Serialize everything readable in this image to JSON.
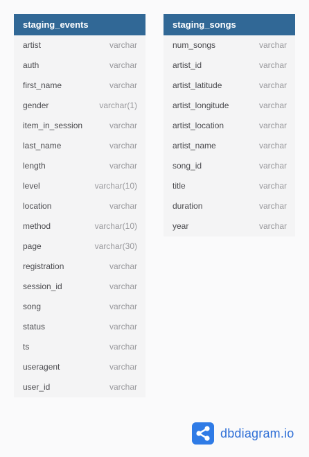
{
  "tables": [
    {
      "name": "staging_events",
      "columns": [
        {
          "name": "artist",
          "type": "varchar"
        },
        {
          "name": "auth",
          "type": "varchar"
        },
        {
          "name": "first_name",
          "type": "varchar"
        },
        {
          "name": "gender",
          "type": "varchar(1)"
        },
        {
          "name": "item_in_session",
          "type": "varchar"
        },
        {
          "name": "last_name",
          "type": "varchar"
        },
        {
          "name": "length",
          "type": "varchar"
        },
        {
          "name": "level",
          "type": "varchar(10)"
        },
        {
          "name": "location",
          "type": "varchar"
        },
        {
          "name": "method",
          "type": "varchar(10)"
        },
        {
          "name": "page",
          "type": "varchar(30)"
        },
        {
          "name": "registration",
          "type": "varchar"
        },
        {
          "name": "session_id",
          "type": "varchar"
        },
        {
          "name": "song",
          "type": "varchar"
        },
        {
          "name": "status",
          "type": "varchar"
        },
        {
          "name": "ts",
          "type": "varchar"
        },
        {
          "name": "useragent",
          "type": "varchar"
        },
        {
          "name": "user_id",
          "type": "varchar"
        }
      ]
    },
    {
      "name": "staging_songs",
      "columns": [
        {
          "name": "num_songs",
          "type": "varchar"
        },
        {
          "name": "artist_id",
          "type": "varchar"
        },
        {
          "name": "artist_latitude",
          "type": "varchar"
        },
        {
          "name": "artist_longitude",
          "type": "varchar"
        },
        {
          "name": "artist_location",
          "type": "varchar"
        },
        {
          "name": "artist_name",
          "type": "varchar"
        },
        {
          "name": "song_id",
          "type": "varchar"
        },
        {
          "name": "title",
          "type": "varchar"
        },
        {
          "name": "duration",
          "type": "varchar"
        },
        {
          "name": "year",
          "type": "varchar"
        }
      ]
    }
  ],
  "brand": {
    "name": "dbdiagram.io",
    "logo_icon": "share-nodes-icon"
  },
  "colors": {
    "header": "#316896",
    "table_body": "#f4f4f5",
    "brand": "#2f7be6"
  }
}
